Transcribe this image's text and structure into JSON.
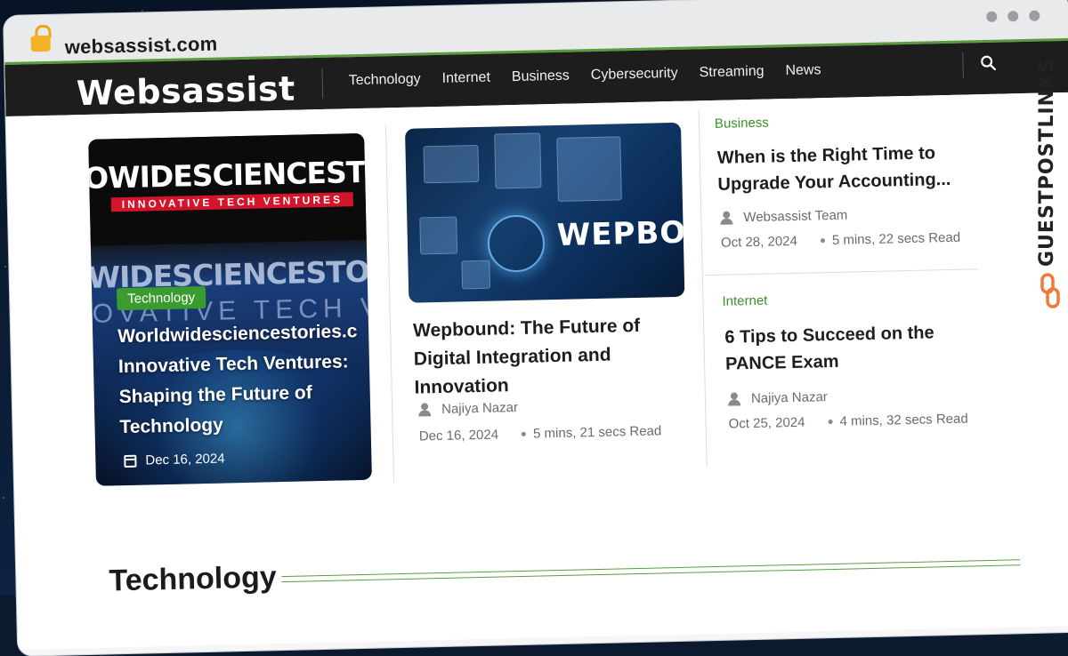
{
  "browser": {
    "url": "websassist.com",
    "lock_icon": "lock-icon"
  },
  "site": {
    "logo": "Websassist",
    "nav": [
      "Technology",
      "Internet",
      "Business",
      "Cybersecurity",
      "Streaming",
      "News"
    ],
    "search_icon": "search-icon"
  },
  "featured": {
    "image_brand": "OWIDESCIENCESTORIES",
    "image_sub": "INNOVATIVE TECH VENTURES",
    "image_brand_bg": "WIDESCIENCESTORIE",
    "image_sub_bg": "OVATIVE TECH VENTU",
    "category": "Technology",
    "title": "Worldwidesciencestories.c Innovative Tech Ventures: Shaping the Future of Technology",
    "date": "Dec 16, 2024"
  },
  "middle": {
    "image_text": "WEPBOU",
    "title": "Wepbound: The Future of Digital Integration and Innovation",
    "author": "Najiya Nazar",
    "date": "Dec 16, 2024",
    "read": "5 mins, 21 secs Read"
  },
  "right": [
    {
      "category": "Business",
      "title": "When is the Right Time to Upgrade Your Accounting...",
      "author": "Websassist Team",
      "date": "Oct 28, 2024",
      "read": "5 mins, 22 secs Read"
    },
    {
      "category": "Internet",
      "title": "6 Tips to Succeed on the PANCE Exam",
      "author": "Najiya Nazar",
      "date": "Oct 25, 2024",
      "read": "4 mins, 32 secs Read"
    }
  ],
  "section": {
    "title": "Technology"
  },
  "watermark": {
    "text": "GUESTPOSTLINKS"
  },
  "colors": {
    "accent_green": "#3a9b2e",
    "nav_bg": "#1d1d1d",
    "lock": "#f4b224",
    "watermark_orange": "#f07a3a"
  }
}
